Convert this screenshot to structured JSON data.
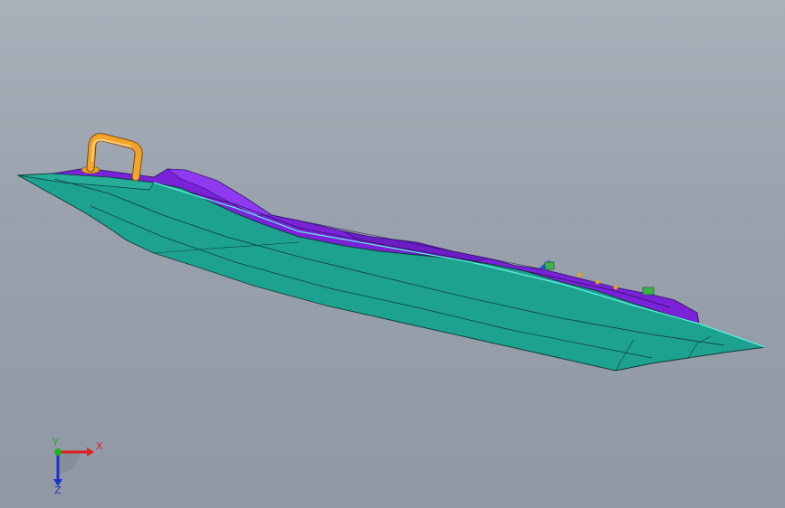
{
  "viewport": {
    "background_top": "#a9b0ba",
    "background_bottom": "#8f98a4"
  },
  "model": {
    "hull_color": "#1f9f8e",
    "deck_color": "#8a2be2",
    "rail_color": "#f2a52a",
    "fitting_color": "#2e8b57"
  },
  "triad": {
    "x_label": "X",
    "y_label": "Y",
    "z_label": "Z",
    "x_color": "#e02020",
    "y_color": "#20b020",
    "z_color": "#2030d0"
  }
}
